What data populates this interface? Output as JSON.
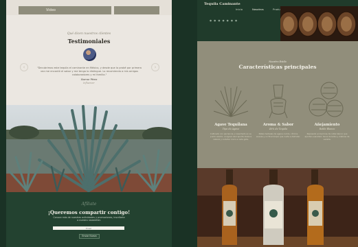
{
  "left": {
    "tabs": [
      "",
      "Video",
      "",
      ""
    ],
    "testimonials": {
      "overline": "Qué dicen nuestros clientes",
      "title": "Testimoniales",
      "quote": "\"Decubrimos este tequila el caminante en México, y desde que lo probé por primera vez me encantó el sabor y me tenga lo distingue. Lo recomiendo a mis amigos colaboradores y mi familia.\"",
      "author_name": "Xiomar Pérez",
      "author_role": "Influencer",
      "prev": "‹",
      "next": "›"
    },
    "newsletter": {
      "script": "Afíliate",
      "title": "¡Queremos compartir contigo!",
      "desc": "Conoce más de nuestras actividades y promociones, inscríbete a nuestro newsletter.",
      "input_placeholder": "Email",
      "button": "Enviar Nuevo"
    }
  },
  "right": {
    "logo": "Tequila Caminante",
    "nav": [
      "Inicio",
      "Nosotros",
      "Productos"
    ],
    "dots": "● ● ● ● ● ● ●",
    "section": {
      "overline": "Nuestro Estilo",
      "title": "Características principales"
    },
    "features": [
      {
        "name": "Agave Tequilana",
        "sub": "Tipo de Agave",
        "desc": "Cultivado con paciencia y cosechado en su punto exacto, el agave azul aporta dulzura natural y carácter único a cada gota."
      },
      {
        "name": "Aroma & Sabor",
        "sub": "40% de Tequila",
        "desc": "Notas herbales de agave cocido, cítricos suaves y un final limpio que invita a disfrutar."
      },
      {
        "name": "Añejamiento",
        "sub": "Roble Blanco",
        "desc": "Reposado en barricas de roble blanco que aportan suavidad, tonos dorados y matices de vainilla."
      }
    ]
  }
}
